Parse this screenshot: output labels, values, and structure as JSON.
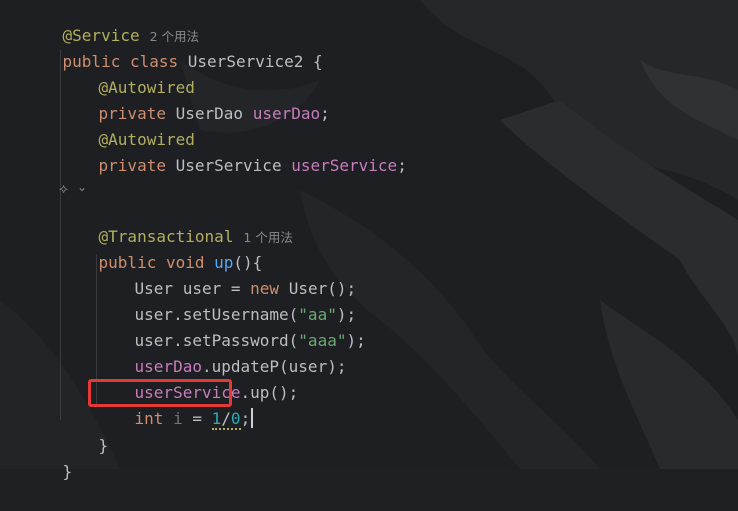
{
  "editor": {
    "line1": {
      "annotation": "@Service",
      "usages": "2 个用法"
    },
    "line2": {
      "kw1": "public",
      "kw2": "class",
      "name": "UserService2",
      "brace": "{"
    },
    "line3": {
      "annotation": "@Autowired"
    },
    "line4": {
      "kw": "private",
      "type": "UserDao",
      "field": "userDao",
      "semi": ";"
    },
    "line5": {
      "annotation": "@Autowired"
    },
    "line6": {
      "kw": "private",
      "type": "UserService",
      "field": "userService",
      "semi": ";"
    },
    "line8": {
      "icon": "⟡",
      "chevron": "⌄"
    },
    "line9": {
      "annotation": "@Transactional",
      "usages": "1 个用法"
    },
    "line10": {
      "kw1": "public",
      "kw2": "void",
      "method": "up",
      "rest": "(){"
    },
    "line11": {
      "type": "User",
      "var": "user",
      "eq": "=",
      "kw": "new",
      "rest": "User();"
    },
    "line12": {
      "pre": "user.setUsername(",
      "str": "\"aa\"",
      "post": ");"
    },
    "line13": {
      "pre": "user.setPassword(",
      "str": "\"aaa\"",
      "post": ");"
    },
    "line14": {
      "field": "userDao",
      "rest": ".updateP(user);"
    },
    "line15": {
      "field": "userService",
      "rest": ".up();"
    },
    "line16": {
      "kw": "int",
      "var": "i",
      "eq": "=",
      "n1": "1",
      "slash": "/",
      "n2": "0",
      "semi": ";"
    },
    "line17": {
      "brace": "}"
    },
    "line18": {
      "brace": "}"
    }
  },
  "colors": {
    "annotation": "#b3ae60",
    "keyword": "#cf8e6d",
    "field": "#c77dbb",
    "method": "#56a8f5",
    "string": "#6aab73",
    "number": "#2aacb8",
    "highlight_box": "#e53935"
  }
}
